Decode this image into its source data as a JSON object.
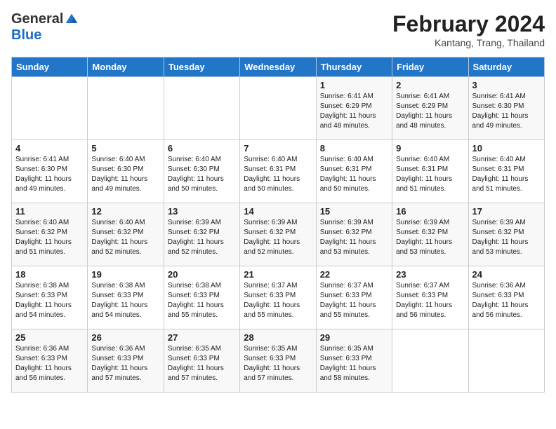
{
  "header": {
    "logo_general": "General",
    "logo_blue": "Blue",
    "title": "February 2024",
    "location": "Kantang, Trang, Thailand"
  },
  "weekdays": [
    "Sunday",
    "Monday",
    "Tuesday",
    "Wednesday",
    "Thursday",
    "Friday",
    "Saturday"
  ],
  "weeks": [
    [
      {
        "day": "",
        "info": ""
      },
      {
        "day": "",
        "info": ""
      },
      {
        "day": "",
        "info": ""
      },
      {
        "day": "",
        "info": ""
      },
      {
        "day": "1",
        "info": "Sunrise: 6:41 AM\nSunset: 6:29 PM\nDaylight: 11 hours\nand 48 minutes."
      },
      {
        "day": "2",
        "info": "Sunrise: 6:41 AM\nSunset: 6:29 PM\nDaylight: 11 hours\nand 48 minutes."
      },
      {
        "day": "3",
        "info": "Sunrise: 6:41 AM\nSunset: 6:30 PM\nDaylight: 11 hours\nand 49 minutes."
      }
    ],
    [
      {
        "day": "4",
        "info": "Sunrise: 6:41 AM\nSunset: 6:30 PM\nDaylight: 11 hours\nand 49 minutes."
      },
      {
        "day": "5",
        "info": "Sunrise: 6:40 AM\nSunset: 6:30 PM\nDaylight: 11 hours\nand 49 minutes."
      },
      {
        "day": "6",
        "info": "Sunrise: 6:40 AM\nSunset: 6:30 PM\nDaylight: 11 hours\nand 50 minutes."
      },
      {
        "day": "7",
        "info": "Sunrise: 6:40 AM\nSunset: 6:31 PM\nDaylight: 11 hours\nand 50 minutes."
      },
      {
        "day": "8",
        "info": "Sunrise: 6:40 AM\nSunset: 6:31 PM\nDaylight: 11 hours\nand 50 minutes."
      },
      {
        "day": "9",
        "info": "Sunrise: 6:40 AM\nSunset: 6:31 PM\nDaylight: 11 hours\nand 51 minutes."
      },
      {
        "day": "10",
        "info": "Sunrise: 6:40 AM\nSunset: 6:31 PM\nDaylight: 11 hours\nand 51 minutes."
      }
    ],
    [
      {
        "day": "11",
        "info": "Sunrise: 6:40 AM\nSunset: 6:32 PM\nDaylight: 11 hours\nand 51 minutes."
      },
      {
        "day": "12",
        "info": "Sunrise: 6:40 AM\nSunset: 6:32 PM\nDaylight: 11 hours\nand 52 minutes."
      },
      {
        "day": "13",
        "info": "Sunrise: 6:39 AM\nSunset: 6:32 PM\nDaylight: 11 hours\nand 52 minutes."
      },
      {
        "day": "14",
        "info": "Sunrise: 6:39 AM\nSunset: 6:32 PM\nDaylight: 11 hours\nand 52 minutes."
      },
      {
        "day": "15",
        "info": "Sunrise: 6:39 AM\nSunset: 6:32 PM\nDaylight: 11 hours\nand 53 minutes."
      },
      {
        "day": "16",
        "info": "Sunrise: 6:39 AM\nSunset: 6:32 PM\nDaylight: 11 hours\nand 53 minutes."
      },
      {
        "day": "17",
        "info": "Sunrise: 6:39 AM\nSunset: 6:32 PM\nDaylight: 11 hours\nand 53 minutes."
      }
    ],
    [
      {
        "day": "18",
        "info": "Sunrise: 6:38 AM\nSunset: 6:33 PM\nDaylight: 11 hours\nand 54 minutes."
      },
      {
        "day": "19",
        "info": "Sunrise: 6:38 AM\nSunset: 6:33 PM\nDaylight: 11 hours\nand 54 minutes."
      },
      {
        "day": "20",
        "info": "Sunrise: 6:38 AM\nSunset: 6:33 PM\nDaylight: 11 hours\nand 55 minutes."
      },
      {
        "day": "21",
        "info": "Sunrise: 6:37 AM\nSunset: 6:33 PM\nDaylight: 11 hours\nand 55 minutes."
      },
      {
        "day": "22",
        "info": "Sunrise: 6:37 AM\nSunset: 6:33 PM\nDaylight: 11 hours\nand 55 minutes."
      },
      {
        "day": "23",
        "info": "Sunrise: 6:37 AM\nSunset: 6:33 PM\nDaylight: 11 hours\nand 56 minutes."
      },
      {
        "day": "24",
        "info": "Sunrise: 6:36 AM\nSunset: 6:33 PM\nDaylight: 11 hours\nand 56 minutes."
      }
    ],
    [
      {
        "day": "25",
        "info": "Sunrise: 6:36 AM\nSunset: 6:33 PM\nDaylight: 11 hours\nand 56 minutes."
      },
      {
        "day": "26",
        "info": "Sunrise: 6:36 AM\nSunset: 6:33 PM\nDaylight: 11 hours\nand 57 minutes."
      },
      {
        "day": "27",
        "info": "Sunrise: 6:35 AM\nSunset: 6:33 PM\nDaylight: 11 hours\nand 57 minutes."
      },
      {
        "day": "28",
        "info": "Sunrise: 6:35 AM\nSunset: 6:33 PM\nDaylight: 11 hours\nand 57 minutes."
      },
      {
        "day": "29",
        "info": "Sunrise: 6:35 AM\nSunset: 6:33 PM\nDaylight: 11 hours\nand 58 minutes."
      },
      {
        "day": "",
        "info": ""
      },
      {
        "day": "",
        "info": ""
      }
    ]
  ]
}
